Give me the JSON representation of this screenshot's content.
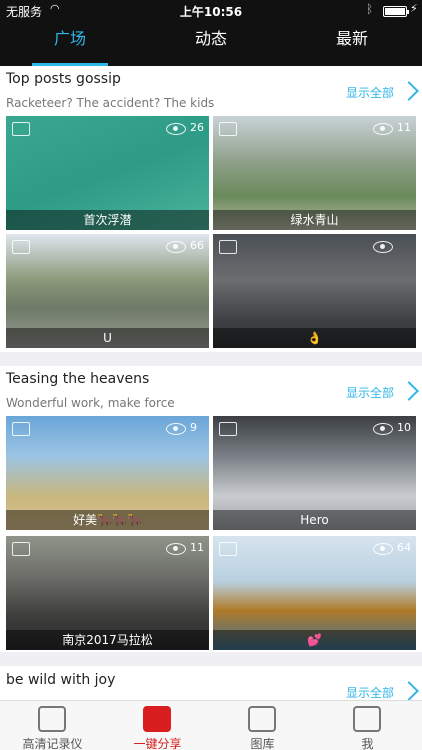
{
  "status": {
    "carrier": "无服务",
    "time": "上午10:56"
  },
  "tabs": [
    {
      "label": "广场",
      "active": true
    },
    {
      "label": "动态",
      "active": false
    },
    {
      "label": "最新",
      "active": false
    }
  ],
  "sections": [
    {
      "title": "Top posts gossip",
      "subtitle": "Racketeer? The accident? The kids",
      "show_all": "显示全部",
      "items": [
        {
          "caption": "首次浮潜",
          "views": "26",
          "type": "video"
        },
        {
          "caption": "绿水青山",
          "views": "11",
          "type": "video"
        },
        {
          "caption": "U",
          "views": "66",
          "type": "photo"
        },
        {
          "caption": "👌",
          "views": "",
          "type": "video"
        }
      ]
    },
    {
      "title": "Teasing the heavens",
      "subtitle": "Wonderful work, make force",
      "show_all": "显示全部",
      "items": [
        {
          "caption": "好美🐂🐂🐂",
          "views": "9",
          "type": "photo"
        },
        {
          "caption": "Hero",
          "views": "10",
          "type": "video"
        },
        {
          "caption": "南京2017马拉松",
          "views": "11",
          "type": "video"
        },
        {
          "caption": "💕",
          "views": "64",
          "type": "video"
        }
      ]
    },
    {
      "title": "be wild with joy",
      "show_all": "显示全部"
    }
  ],
  "bottom_nav": [
    {
      "label": "高清记录仪",
      "icon": "camera-icon"
    },
    {
      "label": "一键分享",
      "icon": "aperture-icon",
      "active": true
    },
    {
      "label": "图库",
      "icon": "gallery-icon"
    },
    {
      "label": "我",
      "icon": "profile-icon"
    }
  ],
  "colors": {
    "accent": "#2fb7e8",
    "share_red": "#d81e1e",
    "header_bg": "#111111"
  }
}
